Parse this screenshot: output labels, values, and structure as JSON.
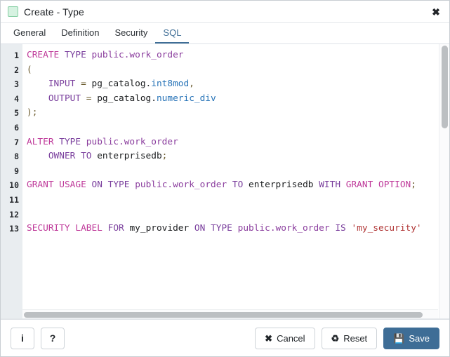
{
  "window": {
    "title": "Create - Type",
    "icon": "type-square-icon",
    "close_label": "✖",
    "accent_color": "#3e6d96",
    "icon_fill": "#d6f2e1",
    "icon_border": "#86cfa4"
  },
  "tabs": [
    {
      "label": "General",
      "name": "tab-general",
      "active": false
    },
    {
      "label": "Definition",
      "name": "tab-definition",
      "active": false
    },
    {
      "label": "Security",
      "name": "tab-security",
      "active": false
    },
    {
      "label": "SQL",
      "name": "tab-sql",
      "active": true
    }
  ],
  "editor": {
    "language": "sql",
    "line_numbers": [
      "1",
      "2",
      "3",
      "4",
      "5",
      "6",
      "7",
      "8",
      "9",
      "10",
      "11",
      "12",
      "13"
    ],
    "lines": [
      "CREATE TYPE public.work_order",
      "(",
      "    INPUT = pg_catalog.int8mod,",
      "    OUTPUT = pg_catalog.numeric_div",
      ");",
      "",
      "ALTER TYPE public.work_order",
      "    OWNER TO enterprisedb;",
      "",
      "GRANT USAGE ON TYPE public.work_order TO enterprisedb WITH GRANT OPTION;",
      "",
      "",
      "SECURITY LABEL FOR my_provider ON TYPE public.work_order IS 'my_security'"
    ],
    "syntax_colors": {
      "keyword": "#bf3a9a",
      "keyword_alt": "#7a3f9d",
      "object": "#8b3e9e",
      "identifier": "#1b1d1f",
      "type": "#2874b8",
      "string": "#b03434"
    }
  },
  "footer": {
    "info_label": "i",
    "help_label": "?",
    "cancel_label": "Cancel",
    "cancel_icon": "✖",
    "reset_label": "Reset",
    "reset_icon": "♻",
    "save_label": "Save",
    "save_icon": "💾"
  }
}
